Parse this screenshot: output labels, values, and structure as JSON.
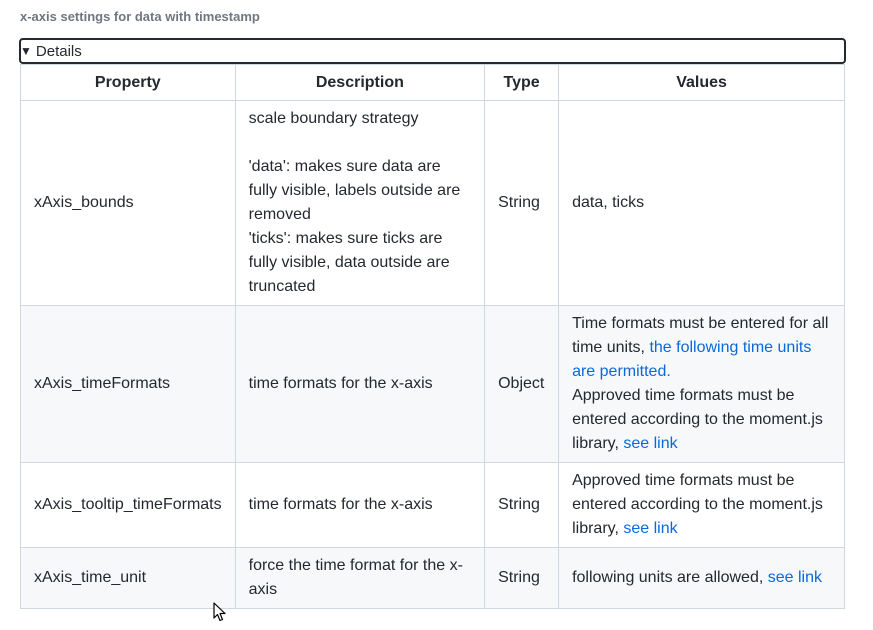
{
  "heading": "x-axis settings for data with timestamp",
  "details": {
    "summary": "Details",
    "toggle_icon": "triangle-down-icon"
  },
  "table": {
    "headers": [
      "Property",
      "Description",
      "Type",
      "Values"
    ],
    "rows": [
      {
        "property": "xAxis_bounds",
        "description": {
          "line1": "scale boundary strategy",
          "line2": "'data': makes sure data are fully visible, labels outside are removed",
          "line3": "'ticks': makes sure ticks are fully visible, data outside are truncated"
        },
        "type": "String",
        "values": {
          "text": "data, ticks"
        }
      },
      {
        "property": "xAxis_timeFormats",
        "description": {
          "line1": "time formats for the x-axis"
        },
        "type": "Object",
        "values": {
          "text1": "Time formats must be entered for all time units,",
          "link1": "the following time units are permitted.",
          "text2": "Approved time formats must be entered according to the moment.js library,",
          "link2": "see link"
        }
      },
      {
        "property": "xAxis_tooltip_timeFormats",
        "description": {
          "line1": "time formats for the x-axis"
        },
        "type": "String",
        "values": {
          "text1": "Approved time formats must be entered according to the moment.js library,",
          "link1": "see link"
        }
      },
      {
        "property": "xAxis_time_unit",
        "description": {
          "line1": "force the time format for the x-axis"
        },
        "type": "String",
        "values": {
          "text1": "following units are allowed,",
          "link1": "see link"
        }
      }
    ]
  },
  "cursor": {
    "icon": "mouse-pointer-icon"
  },
  "colors": {
    "link": "#0969da",
    "border": "#d0d7de",
    "alt_row": "#f6f8fa",
    "text": "#24292f"
  }
}
